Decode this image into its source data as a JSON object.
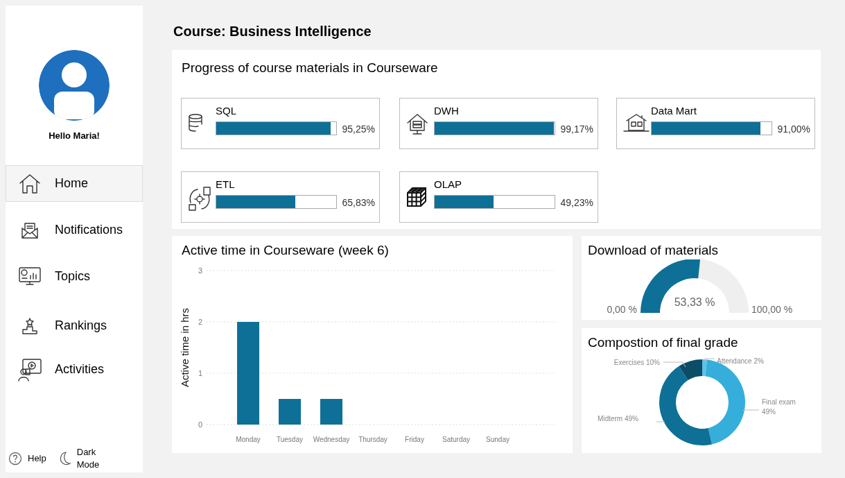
{
  "sidebar": {
    "greeting": "Hello Maria!",
    "items": [
      {
        "label": "Home",
        "selected": true
      },
      {
        "label": "Notifications",
        "selected": false
      },
      {
        "label": "Topics",
        "selected": false
      },
      {
        "label": "Rankings",
        "selected": false
      },
      {
        "label": "Activities",
        "selected": false
      }
    ],
    "footer": [
      "Help",
      "Dark Mode"
    ]
  },
  "title": "Course: Business Intelligence",
  "progress": {
    "title": "Progress of course materials in Courseware",
    "materials": [
      {
        "name": "SQL",
        "level": 0.9525,
        "reading": "95,25%"
      },
      {
        "name": "DWH",
        "level": 0.9917,
        "reading": "99,17%"
      },
      {
        "name": "Data Mart",
        "level": 0.91,
        "reading": "91,00%"
      },
      {
        "name": "ETL",
        "level": 0.6583,
        "reading": "65,83%"
      },
      {
        "name": "OLAP",
        "level": 0.4923,
        "reading": "49,23%"
      }
    ]
  },
  "active_time": {
    "chart_data": {
      "type": "bar",
      "title": "Active time in Courseware (week 6)",
      "ylabel": "Active time in hrs",
      "categories": [
        "Monday",
        "Tuesday",
        "Wednesday",
        "Thursday",
        "Friday",
        "Saturday",
        "Sunday"
      ],
      "values": [
        2,
        0.5,
        0.5,
        0,
        0,
        0,
        0
      ],
      "ylim": [
        0,
        3
      ],
      "yticks": [
        0,
        1,
        2,
        3
      ]
    }
  },
  "downloads": {
    "title": "Download of materials",
    "reading": "53,33 %",
    "min": "0,00 %",
    "max": "100,00 %"
  },
  "grade": {
    "title": "Compostion of final grade",
    "chart_data": {
      "type": "donut",
      "categories": [
        "Attendance",
        "Final exam",
        "Midterm",
        "Exercises"
      ],
      "values": [
        2,
        49,
        49,
        10
      ],
      "value_labels": [
        "2%",
        "49%",
        "49%",
        "10%"
      ]
    }
  }
}
